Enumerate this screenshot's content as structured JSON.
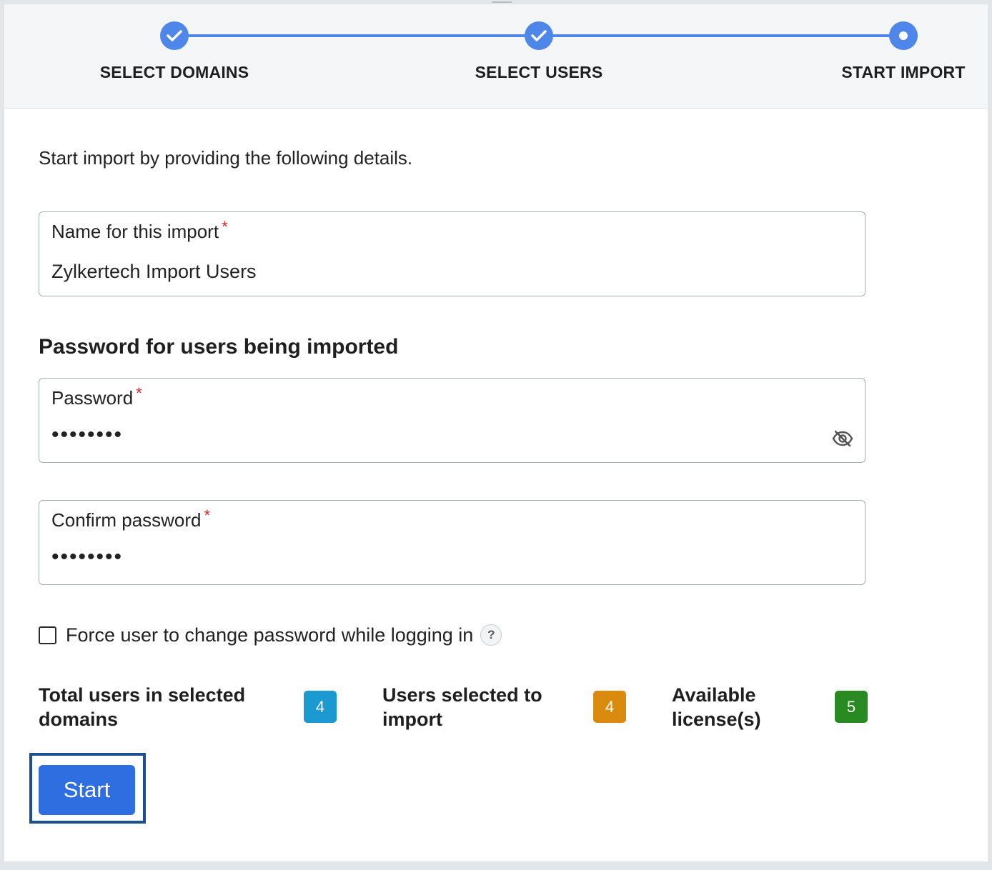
{
  "stepper": {
    "steps": [
      {
        "label": "SELECT DOMAINS",
        "status": "completed",
        "icon": "check-icon"
      },
      {
        "label": "SELECT USERS",
        "status": "completed",
        "icon": "check-icon"
      },
      {
        "label": "START IMPORT",
        "status": "current",
        "icon": "current-step-dot-icon"
      }
    ]
  },
  "intro": "Start import by providing the following details.",
  "import_name": {
    "label": "Name for this import",
    "required_mark": "*",
    "value": "Zylkertech Import Users"
  },
  "password_section": {
    "heading": "Password for users being imported",
    "password": {
      "label": "Password",
      "required_mark": "*",
      "masked_value": "••••••••",
      "toggle_icon": "eye-off-icon"
    },
    "confirm_password": {
      "label": "Confirm password",
      "required_mark": "*",
      "masked_value": "••••••••"
    }
  },
  "force_change": {
    "label": "Force user to change password while logging in",
    "checked": false,
    "help_icon": "help-icon",
    "help_glyph": "?"
  },
  "stats": [
    {
      "label": "Total users in selected domains",
      "value": "4",
      "color": "#1a9ad1"
    },
    {
      "label": "Users selected to import",
      "value": "4",
      "color": "#db8a10"
    },
    {
      "label": "Available license(s)",
      "value": "5",
      "color": "#2a8a22"
    }
  ],
  "colors": {
    "accent": "#4f86ea",
    "primary_button": "#2f6ee0",
    "required": "#d62b2b"
  },
  "actions": {
    "start_label": "Start"
  }
}
